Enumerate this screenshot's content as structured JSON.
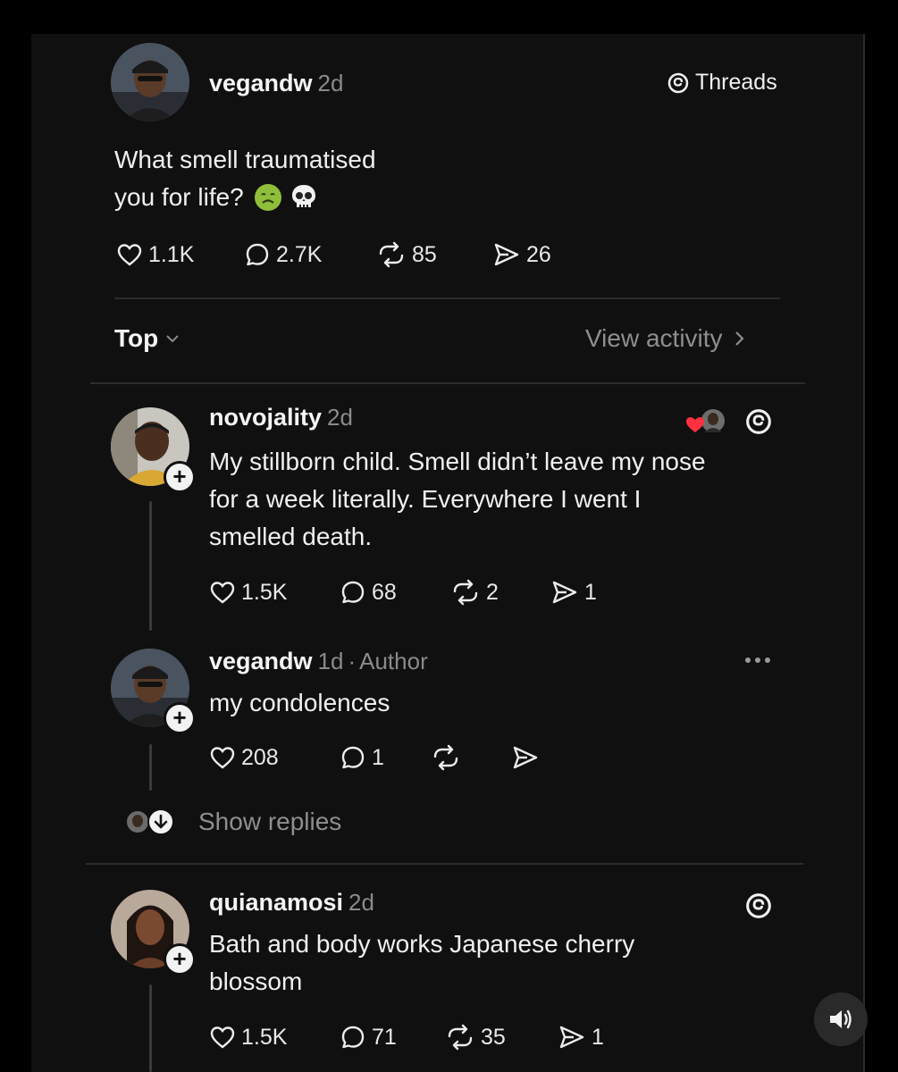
{
  "post": {
    "username": "vegandw",
    "time": "2d",
    "brand_label": "Threads",
    "text_line1": "What smell traumatised",
    "text_line2": "you for life?",
    "emoji": [
      "nauseated-face",
      "skull"
    ],
    "likes": "1.1K",
    "replies": "2.7K",
    "reposts": "85",
    "shares": "26"
  },
  "sort": {
    "label": "Top",
    "activity_label": "View activity"
  },
  "comments": [
    {
      "username": "novojality",
      "time": "2d",
      "text_lines": [
        "My stillborn child. Smell didn’t leave my nose",
        "for a week literally. Everywhere I went I",
        "smelled death."
      ],
      "likes": "1.5K",
      "replies": "68",
      "reposts": "2",
      "shares": "1"
    },
    {
      "username": "vegandw",
      "time": "1d",
      "role": "Author",
      "separator": "·",
      "text_lines": [
        "my condolences"
      ],
      "likes": "208",
      "replies": "1",
      "show_replies_label": "Show replies"
    },
    {
      "username": "quianamosi",
      "time": "2d",
      "text_lines": [
        "Bath and body works Japanese cherry",
        "blossom"
      ],
      "likes": "1.5K",
      "replies": "71",
      "reposts": "35",
      "shares": "1"
    }
  ],
  "colors": {
    "background": "#101010",
    "text": "#f3f3f3",
    "muted": "#8a8a8a",
    "heart_red": "#ff3040"
  }
}
